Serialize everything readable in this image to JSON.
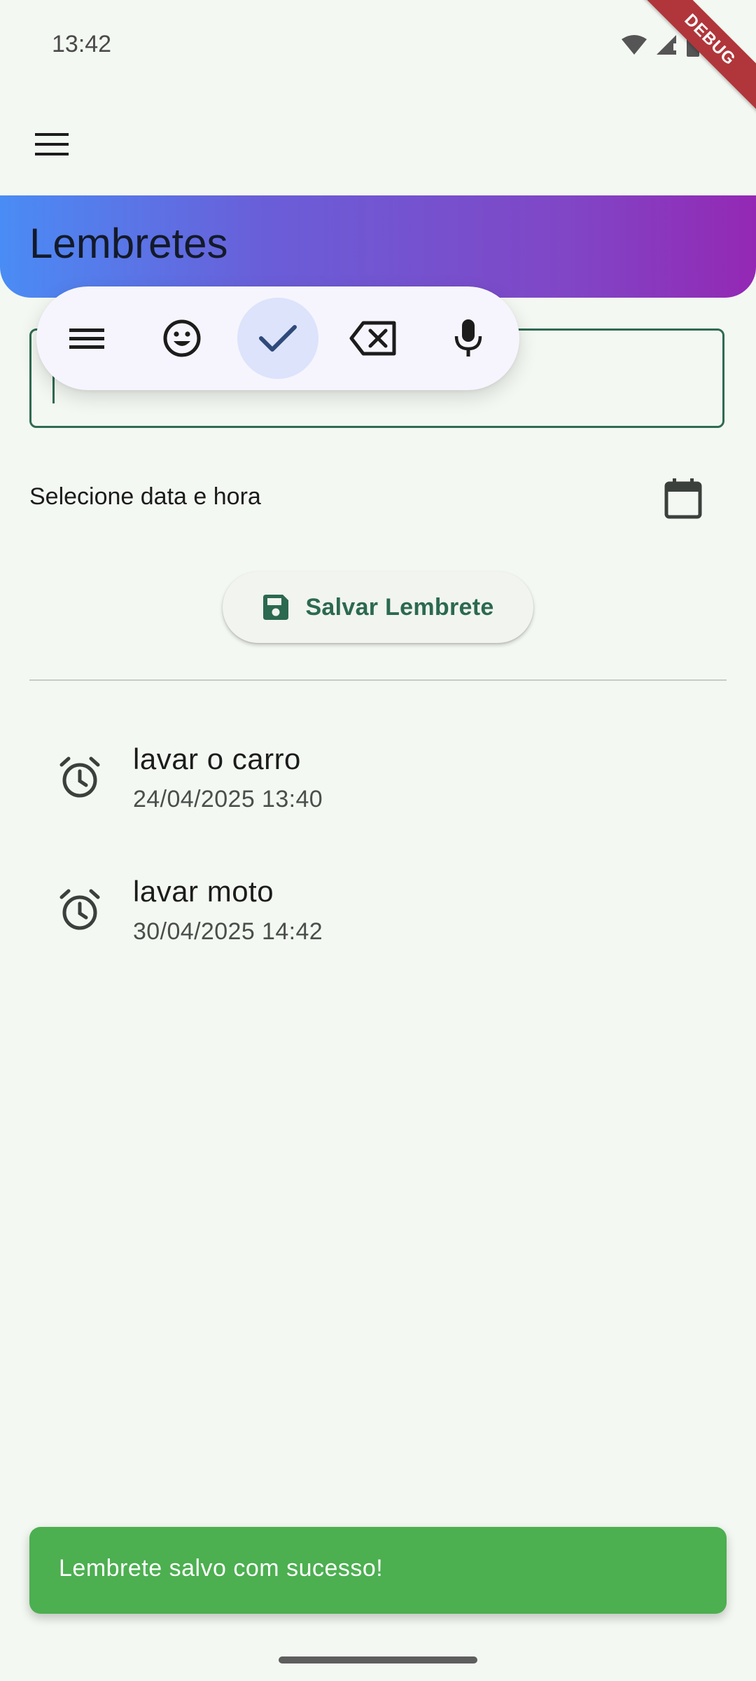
{
  "status_bar": {
    "time": "13:42"
  },
  "debug_banner": "DEBUG",
  "app_bar": {
    "menu_icon": "hamburger-menu-icon",
    "title": "Lembretes"
  },
  "input": {
    "value": ""
  },
  "keyboard_toolbar": {
    "buttons": [
      {
        "icon": "menu-lines-icon"
      },
      {
        "icon": "emoji-icon"
      },
      {
        "icon": "checkmark-icon",
        "active": true
      },
      {
        "icon": "backspace-icon"
      },
      {
        "icon": "microphone-icon"
      }
    ]
  },
  "date_picker": {
    "label": "Selecione data e hora",
    "icon": "calendar-icon"
  },
  "save_button": {
    "label": "Salvar Lembrete",
    "icon": "save-icon"
  },
  "reminders": [
    {
      "title": "lavar o carro",
      "datetime": "24/04/2025 13:40",
      "icon": "alarm-icon"
    },
    {
      "title": "lavar moto",
      "datetime": "30/04/2025 14:42",
      "icon": "alarm-icon"
    }
  ],
  "snackbar": {
    "message": "Lembrete salvo com sucesso!"
  },
  "colors": {
    "background": "#f4f8f2",
    "primary": "#2f6b52",
    "snackbar": "#4caf50",
    "gradient_start": "#4a8cf5",
    "gradient_end": "#9428b4",
    "debug_ribbon": "#b0363b"
  }
}
